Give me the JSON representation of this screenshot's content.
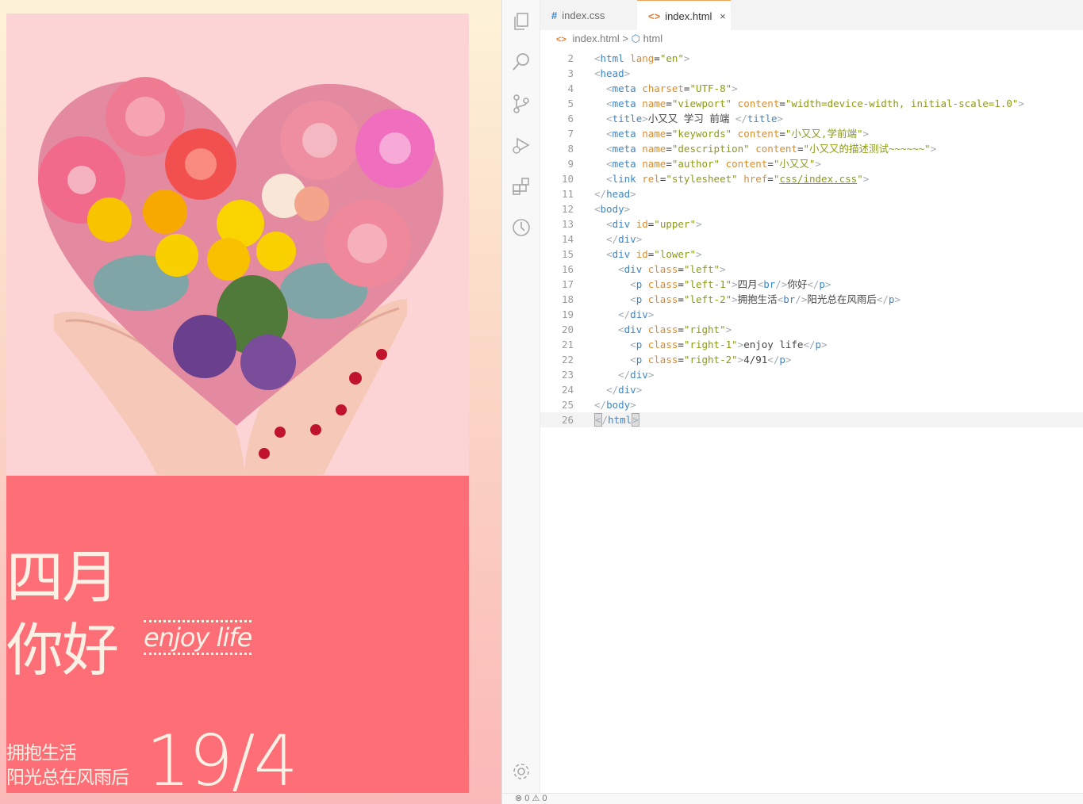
{
  "preview": {
    "left_1_line1": "四月",
    "left_1_line2": "你好",
    "right_1": "enjoy life",
    "left_2_line1": "拥抱生活",
    "left_2_line2": "阳光总在风雨后",
    "right_2": "19/4"
  },
  "editor": {
    "tabs": [
      {
        "icon": "#",
        "label": "index.css"
      },
      {
        "icon": "<>",
        "label": "index.html",
        "close": "×"
      }
    ],
    "breadcrumb": {
      "file": "index.html",
      "sep": ">",
      "node": "html"
    },
    "code": [
      {
        "n": "2",
        "html": "<span class='g'>&lt;</span><span class='t'>html</span> <span class='a'>lang</span>=<span class='s'>\"en\"</span><span class='g'>&gt;</span>"
      },
      {
        "n": "3",
        "html": "<span class='g'>&lt;</span><span class='t'>head</span><span class='g'>&gt;</span>"
      },
      {
        "n": "4",
        "html": "  <span class='g'>&lt;</span><span class='t'>meta</span> <span class='a'>charset</span>=<span class='s'>\"UTF-8\"</span><span class='g'>&gt;</span>"
      },
      {
        "n": "5",
        "html": "  <span class='g'>&lt;</span><span class='t'>meta</span> <span class='a'>name</span>=<span class='s'>\"viewport\"</span> <span class='a'>content</span>=<span class='s'>\"width=device-width, initial-scale=1.0\"</span><span class='g'>&gt;</span>"
      },
      {
        "n": "6",
        "html": "  <span class='g'>&lt;</span><span class='t'>title</span><span class='g'>&gt;</span><span class='d'>小又又 学习 前端 </span><span class='g'>&lt;/</span><span class='t'>title</span><span class='g'>&gt;</span>"
      },
      {
        "n": "7",
        "html": "  <span class='g'>&lt;</span><span class='t'>meta</span> <span class='a'>name</span>=<span class='s'>\"keywords\"</span> <span class='a'>content</span>=<span class='s'>\"小又又,学前端\"</span><span class='g'>&gt;</span>"
      },
      {
        "n": "8",
        "html": "  <span class='g'>&lt;</span><span class='t'>meta</span> <span class='a'>name</span>=<span class='s'>\"description\"</span> <span class='a'>content</span>=<span class='s'>\"小又又的描述测试~~~~~~\"</span><span class='g'>&gt;</span>"
      },
      {
        "n": "9",
        "html": "  <span class='g'>&lt;</span><span class='t'>meta</span> <span class='a'>name</span>=<span class='s'>\"author\"</span> <span class='a'>content</span>=<span class='s'>\"小又又\"</span><span class='g'>&gt;</span>"
      },
      {
        "n": "10",
        "html": "  <span class='g'>&lt;</span><span class='t'>link</span> <span class='a'>rel</span>=<span class='s'>\"stylesheet\"</span> <span class='a'>href</span>=<span class='s'>\"<span class='u'>css/index.css</span>\"</span><span class='g'>&gt;</span>"
      },
      {
        "n": "11",
        "html": "<span class='g'>&lt;/</span><span class='t'>head</span><span class='g'>&gt;</span>"
      },
      {
        "n": "12",
        "html": "<span class='g'>&lt;</span><span class='t'>body</span><span class='g'>&gt;</span>"
      },
      {
        "n": "13",
        "html": "  <span class='g'>&lt;</span><span class='t'>div</span> <span class='a'>id</span>=<span class='s'>\"upper\"</span><span class='g'>&gt;</span>"
      },
      {
        "n": "14",
        "html": "  <span class='g'>&lt;/</span><span class='t'>div</span><span class='g'>&gt;</span>"
      },
      {
        "n": "15",
        "html": "  <span class='g'>&lt;</span><span class='t'>div</span> <span class='a'>id</span>=<span class='s'>\"lower\"</span><span class='g'>&gt;</span>"
      },
      {
        "n": "16",
        "html": "    <span class='g'>&lt;</span><span class='t'>div</span> <span class='a'>class</span>=<span class='s'>\"left\"</span><span class='g'>&gt;</span>"
      },
      {
        "n": "17",
        "html": "      <span class='g'>&lt;</span><span class='t'>p</span> <span class='a'>class</span>=<span class='s'>\"left-1\"</span><span class='g'>&gt;</span><span class='d'>四月</span><span class='g'>&lt;</span><span class='t'>br</span><span class='g'>/&gt;</span><span class='d'>你好</span><span class='g'>&lt;/</span><span class='t'>p</span><span class='g'>&gt;</span>"
      },
      {
        "n": "18",
        "html": "      <span class='g'>&lt;</span><span class='t'>p</span> <span class='a'>class</span>=<span class='s'>\"left-2\"</span><span class='g'>&gt;</span><span class='d'>拥抱生活</span><span class='g'>&lt;</span><span class='t'>br</span><span class='g'>/&gt;</span><span class='d'>阳光总在风雨后</span><span class='g'>&lt;/</span><span class='t'>p</span><span class='g'>&gt;</span>"
      },
      {
        "n": "19",
        "html": "    <span class='g'>&lt;/</span><span class='t'>div</span><span class='g'>&gt;</span>"
      },
      {
        "n": "20",
        "html": "    <span class='g'>&lt;</span><span class='t'>div</span> <span class='a'>class</span>=<span class='s'>\"right\"</span><span class='g'>&gt;</span>"
      },
      {
        "n": "21",
        "html": "      <span class='g'>&lt;</span><span class='t'>p</span> <span class='a'>class</span>=<span class='s'>\"right-1\"</span><span class='g'>&gt;</span><span class='d'>enjoy life</span><span class='g'>&lt;/</span><span class='t'>p</span><span class='g'>&gt;</span>"
      },
      {
        "n": "22",
        "html": "      <span class='g'>&lt;</span><span class='t'>p</span> <span class='a'>class</span>=<span class='s'>\"right-2\"</span><span class='g'>&gt;</span><span class='d'>4/91</span><span class='g'>&lt;/</span><span class='t'>p</span><span class='g'>&gt;</span>"
      },
      {
        "n": "23",
        "html": "    <span class='g'>&lt;/</span><span class='t'>div</span><span class='g'>&gt;</span>"
      },
      {
        "n": "24",
        "html": "  <span class='g'>&lt;/</span><span class='t'>div</span><span class='g'>&gt;</span>"
      },
      {
        "n": "25",
        "html": "<span class='g'>&lt;/</span><span class='t'>body</span><span class='g'>&gt;</span>"
      },
      {
        "n": "26",
        "html": "<span class='g' style='background:#ddd;border:1px solid #aaa'>&lt;</span><span class='g'>/</span><span class='t'>html</span><span class='g' style='background:#ddd;border:1px solid #aaa'>&gt;</span>",
        "current": true
      }
    ],
    "status": "⊗ 0 ⚠ 0"
  },
  "activity_icons": [
    "explorer-icon",
    "search-icon",
    "source-control-icon",
    "run-debug-icon",
    "extensions-icon",
    "timeline-icon",
    "settings-gear-icon"
  ]
}
